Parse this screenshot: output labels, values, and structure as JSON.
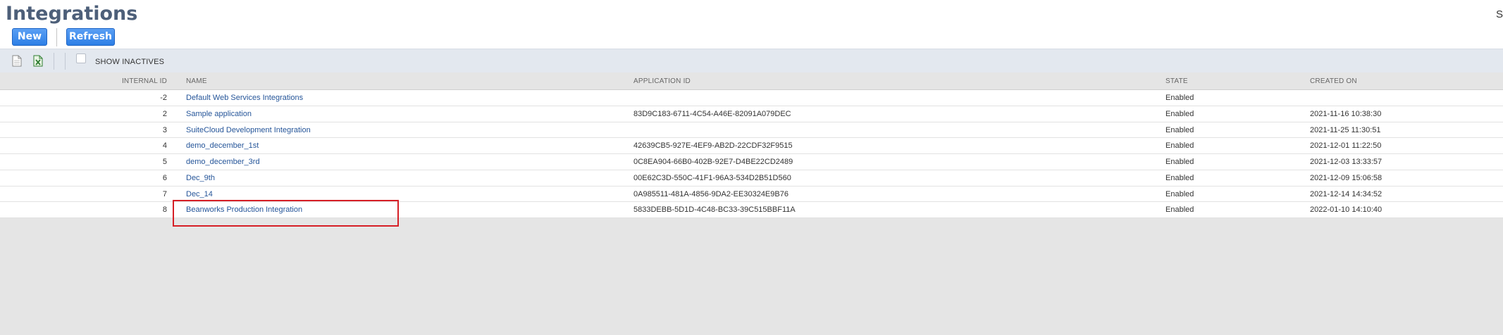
{
  "header": {
    "title": "Integrations",
    "corner_text": "Se",
    "new_label": "New",
    "refresh_label": "Refresh"
  },
  "toolbar": {
    "show_inactives_label": "SHOW INACTIVES",
    "show_inactives_checked": false
  },
  "table": {
    "columns": {
      "internal_id": "INTERNAL ID",
      "name": "NAME",
      "application_id": "APPLICATION ID",
      "state": "STATE",
      "created_on": "CREATED ON"
    },
    "rows": [
      {
        "internal_id": "-2",
        "name": "Default Web Services Integrations",
        "application_id": "",
        "state": "Enabled",
        "created_on": ""
      },
      {
        "internal_id": "2",
        "name": "Sample application",
        "application_id": "83D9C183-6711-4C54-A46E-82091A079DEC",
        "state": "Enabled",
        "created_on": "2021-11-16 10:38:30"
      },
      {
        "internal_id": "3",
        "name": "SuiteCloud Development Integration",
        "application_id": "",
        "state": "Enabled",
        "created_on": "2021-11-25 11:30:51"
      },
      {
        "internal_id": "4",
        "name": "demo_december_1st",
        "application_id": "42639CB5-927E-4EF9-AB2D-22CDF32F9515",
        "state": "Enabled",
        "created_on": "2021-12-01 11:22:50"
      },
      {
        "internal_id": "5",
        "name": "demo_december_3rd",
        "application_id": "0C8EA904-66B0-402B-92E7-D4BE22CD2489",
        "state": "Enabled",
        "created_on": "2021-12-03 13:33:57"
      },
      {
        "internal_id": "6",
        "name": "Dec_9th",
        "application_id": "00E62C3D-550C-41F1-96A3-534D2B51D560",
        "state": "Enabled",
        "created_on": "2021-12-09 15:06:58"
      },
      {
        "internal_id": "7",
        "name": "Dec_14",
        "application_id": "0A985511-481A-4856-9DA2-EE30324E9B76",
        "state": "Enabled",
        "created_on": "2021-12-14 14:34:52"
      },
      {
        "internal_id": "8",
        "name": "Beanworks Production Integration",
        "application_id": "5833DEBB-5D1D-4C48-BC33-39C515BBF11A",
        "state": "Enabled",
        "created_on": "2022-01-10 14:10:40"
      }
    ]
  },
  "colors": {
    "title": "#4d5f79",
    "link": "#255599",
    "button": "#2d7fe6",
    "toolbar_bg": "#e3e8ef",
    "highlight": "#d61f26"
  }
}
